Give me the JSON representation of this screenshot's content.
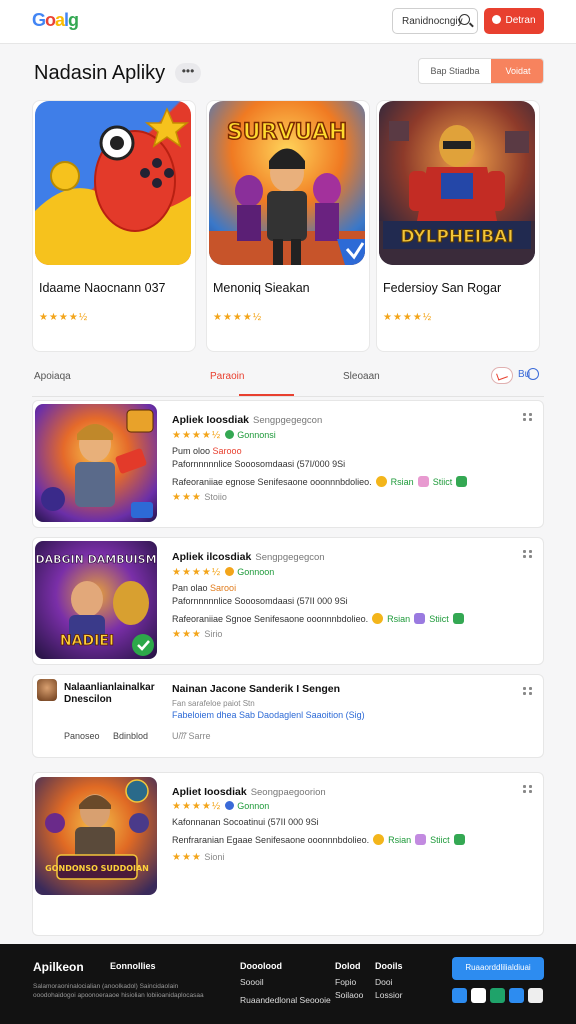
{
  "header": {
    "logo_text": "Goalg",
    "search_placeholder": "Ranidnocngiy",
    "login_label": "Detran"
  },
  "featured": {
    "title": "Nadasin Apliky",
    "more_label": "•••",
    "seg_option_a": "Bap Stiadba",
    "seg_option_b": "Voidat",
    "cards": [
      {
        "name": "Idaame Naocnann 037",
        "rating": 4.5,
        "stars": "★★★★½"
      },
      {
        "name": "Menoniq Sieakan",
        "rating": 4.5,
        "stars": "★★★★½",
        "art_text": "SURVUAH"
      },
      {
        "name": "Federsioy San Rogar",
        "rating": 4.5,
        "stars": "★★★★½",
        "art_text": "DYLPHEIBAI"
      }
    ]
  },
  "tabs": {
    "items": [
      "Apoiaqa",
      "Paraoin",
      "Sleoaan"
    ],
    "active_index": 1,
    "extra_label": "Bu"
  },
  "list": [
    {
      "title": "Apliek Ioosdiak",
      "subtitle": "Sengpgegegcon",
      "stars": "★★★★½",
      "badge_label": "Gonnonsi",
      "meta": "Pum oloo",
      "meta_accent": "Sarooo",
      "line": "Pafornnnnnlice Sooosomdaasi (57I/000 9Si",
      "desc": "Rafeoraniiae egnose Senifesaone ooonnnbdolieo.",
      "tag1": "Rsian",
      "tag2": "Stiict",
      "footer_stars": "★★★",
      "footer_label": "Stoiio"
    },
    {
      "title": "Apliek ilcosdiak",
      "subtitle": "Sengpgegegcon",
      "stars": "★★★★½",
      "badge_label": "Gonnoon",
      "meta": "Pan olao",
      "meta_accent": "Sarooi",
      "line": "Pafornnnnnlice Sooosomdaasi (57II 000 9Si",
      "desc": "Rafeoraniiae Sgnoe Senifesaone ooonnnbdolieo.",
      "tag1": "Rsian",
      "tag2": "Stiict",
      "footer_stars": "★★★",
      "footer_label": "Sirio",
      "art_text": "DABGIN DAMBUISM",
      "art_text2": "NADIEI"
    },
    {
      "title": "Nainan Jacone Sanderik I Sengen",
      "left_title": "Nalaanlianlainalkar Dnescilon",
      "line1": "Fan sarafeloe paiot Stn",
      "line2": "Fabeloiem dhea Sab Daodaglenl Saaoition (Sig)",
      "col1": "Panoseo",
      "col2": "Bdinblod",
      "footer_label": "U/̆/̆̆/̆ Sarre"
    },
    {
      "title": "Apliet Ioosdiak",
      "subtitle": "Seongpaegoorion",
      "stars": "★★★★½",
      "badge_label": "Gonnon",
      "line": "Kafonnanan Socoatinui (57II 000 9Si",
      "desc": "Renfraranian Egaae Senifesaone ooonnnbdolieo.",
      "tag1": "Rsian",
      "tag2": "Stiict",
      "footer_stars": "★★★",
      "footer_label": "Sioni",
      "art_text": "GONDONSO SUDDOIAN"
    }
  ],
  "footer": {
    "brand": "Apilkeon",
    "desc": "Salamoraoninalocialian (anoolkadol) Saincidaolain ooodohaidogoi apoonoeraaoe hisiolian lobiioanidaplocasaa",
    "col1_title": "Eonnollies",
    "col2_title": "Dooolood",
    "col2_items": [
      "Soooil",
      "Ruaandedlonal Seoooie"
    ],
    "col3_title": "Dolod",
    "col3_items": [
      "Fopio",
      "Soilaoo"
    ],
    "col4_title": "Dooils",
    "col4_items": [
      "Dooi",
      "Lossior"
    ],
    "cta_label": "Ruaaorddlilialdiuai"
  },
  "colors": {
    "accent": "#e8402f",
    "accent_soft": "#f7835e",
    "star": "#f3a51b",
    "link_blue": "#2d8cf0",
    "footer_bg": "#121212"
  }
}
